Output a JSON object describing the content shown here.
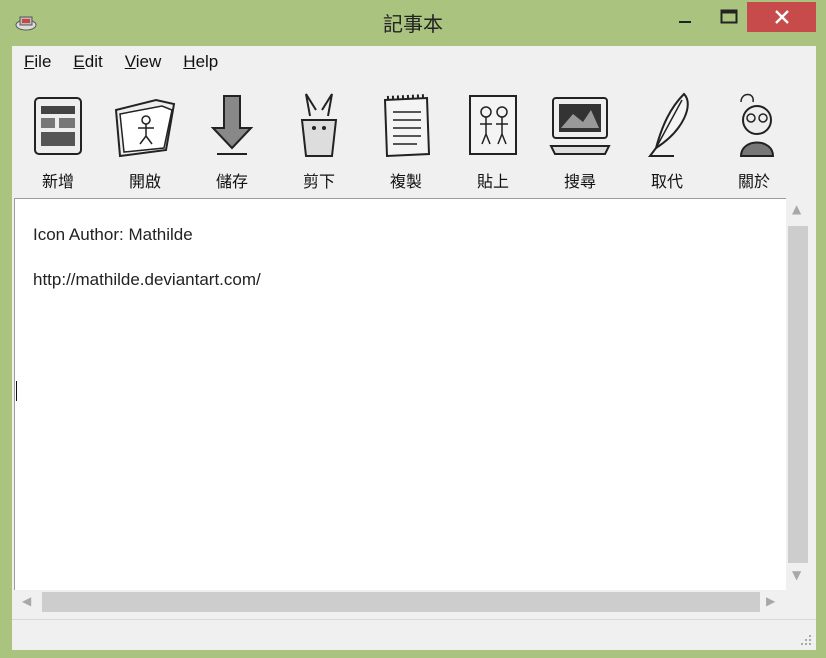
{
  "window": {
    "title": "記事本"
  },
  "menu": {
    "file": "File",
    "edit": "Edit",
    "view": "View",
    "help": "Help"
  },
  "toolbar": {
    "items": [
      {
        "label": "新增",
        "icon": "new-document-icon"
      },
      {
        "label": "開啟",
        "icon": "open-folder-icon"
      },
      {
        "label": "儲存",
        "icon": "save-arrow-icon"
      },
      {
        "label": "剪下",
        "icon": "cut-rabbit-icon"
      },
      {
        "label": "複製",
        "icon": "copy-notepad-icon"
      },
      {
        "label": "貼上",
        "icon": "paste-picture-icon"
      },
      {
        "label": "搜尋",
        "icon": "search-computer-icon"
      },
      {
        "label": "取代",
        "icon": "replace-feather-icon"
      },
      {
        "label": "關於",
        "icon": "about-person-icon"
      }
    ]
  },
  "editor": {
    "lines": [
      "Icon Author: Mathilde",
      "http://mathilde.deviantart.com/"
    ]
  },
  "colors": {
    "window_frame": "#aac47f",
    "close_button": "#c74b4b",
    "client": "#f0f0f0"
  }
}
